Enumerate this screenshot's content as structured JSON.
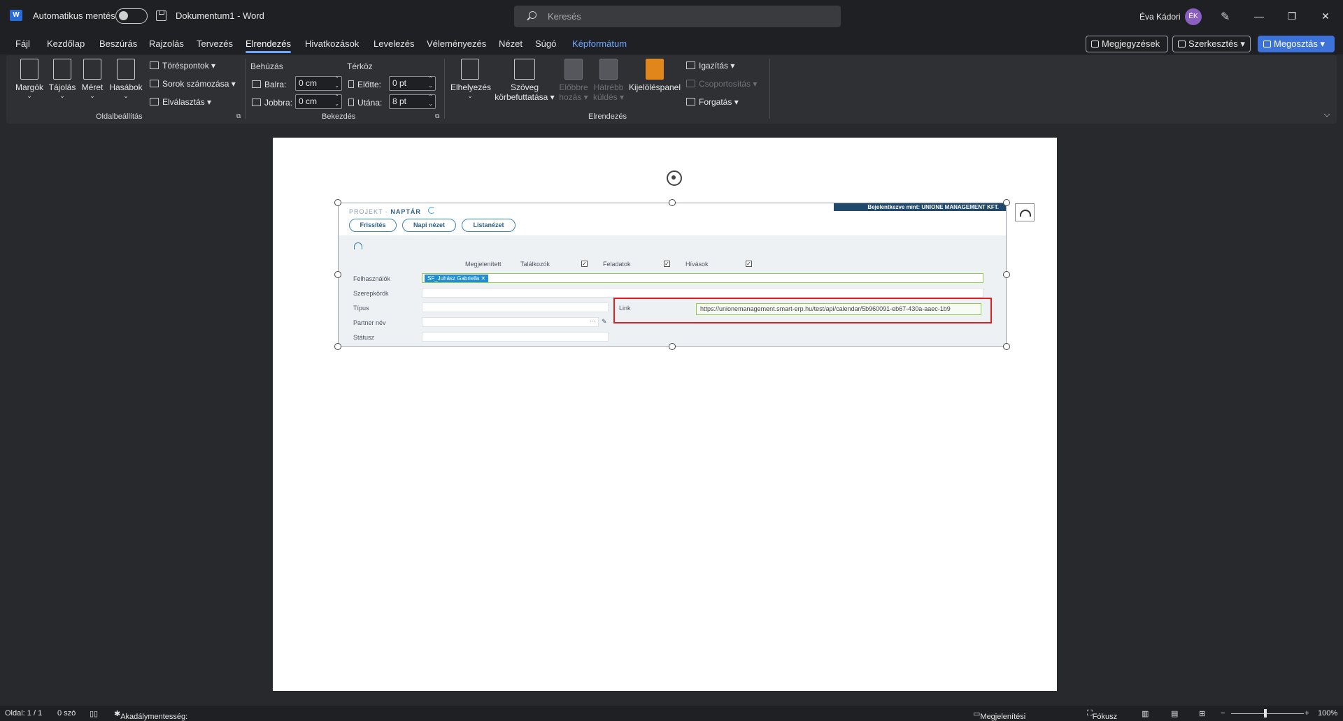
{
  "titlebar": {
    "app_letter": "W",
    "autosave_label": "Automatikus mentés",
    "document_title": "Dokumentum1 - Word",
    "search_placeholder": "Keresés",
    "user_name": "Éva Kádori",
    "user_initials": "ÉK"
  },
  "tabs": [
    {
      "label": "Fájl"
    },
    {
      "label": "Kezdőlap"
    },
    {
      "label": "Beszúrás"
    },
    {
      "label": "Rajzolás"
    },
    {
      "label": "Tervezés"
    },
    {
      "label": "Elrendezés",
      "active": true
    },
    {
      "label": "Hivatkozások"
    },
    {
      "label": "Levelezés"
    },
    {
      "label": "Véleményezés"
    },
    {
      "label": "Nézet"
    },
    {
      "label": "Súgó"
    },
    {
      "label": "Képformátum",
      "accent": "#6ea7ff"
    }
  ],
  "top_buttons": {
    "comments": "Megjegyzések",
    "editing": "Szerkesztés",
    "share": "Megosztás"
  },
  "ribbon": {
    "page_setup": {
      "margins": "Margók",
      "orientation": "Tájolás",
      "size": "Méret",
      "columns": "Hasábok",
      "breaks": "Töréspontok",
      "line_numbers": "Sorok számozása",
      "hyphenation": "Elválasztás",
      "group_label": "Oldalbeállítás"
    },
    "paragraph": {
      "indent_title": "Behúzás",
      "spacing_title": "Térköz",
      "left_label": "Balra:",
      "left_value": "0 cm",
      "right_label": "Jobbra:",
      "right_value": "0 cm",
      "before_label": "Előtte:",
      "before_value": "0 pt",
      "after_label": "Utána:",
      "after_value": "8 pt",
      "group_label": "Bekezdés"
    },
    "arrange": {
      "position": "Elhelyezés",
      "wrap_line1": "Szöveg",
      "wrap_line2": "körbefuttatása",
      "forward_line1": "Előbbre",
      "forward_line2": "hozás",
      "backward_line1": "Hátrébb",
      "backward_line2": "küldés",
      "selection_pane": "Kijelöléspanel",
      "align": "Igazítás",
      "group": "Csoportosítás",
      "rotate": "Forgatás",
      "group_label": "Elrendezés"
    }
  },
  "erp": {
    "title_prefix": "PROJEKT -",
    "title_main": "NAPTÁR",
    "login_text": "Bejelentkezve mint: UNIONE MANAGEMENT KFT.",
    "buttons": [
      "Frissítés",
      "Napi nézet",
      "Listanézet"
    ],
    "shown_label": "Megjelenített",
    "meetings_label": "Találkozók",
    "tasks_label": "Feladatok",
    "calls_label": "Hívások",
    "users_label": "Felhasználók",
    "user_tag": "SF_Juhász Gabriella",
    "roles_label": "Szerepkörök",
    "type_label": "Típus",
    "partner_label": "Partner név",
    "status_label": "Státusz",
    "link_label": "Link",
    "link_value": "https://unionemanagement.smart-erp.hu/test/api/calendar/5b960091-eb67-430a-aaec-1b9"
  },
  "statusbar": {
    "page": "Oldal: 1 / 1",
    "words": "0 szó",
    "accessibility": "Akadálymentesség: módosítás javasolt",
    "display_settings": "Megjelenítési beállítások",
    "focus": "Fókusz",
    "zoom": "100%"
  },
  "colors": {
    "accent": "#6ea7ff",
    "share_button": "#3d73d9",
    "highlight_border": "#e0201f"
  }
}
